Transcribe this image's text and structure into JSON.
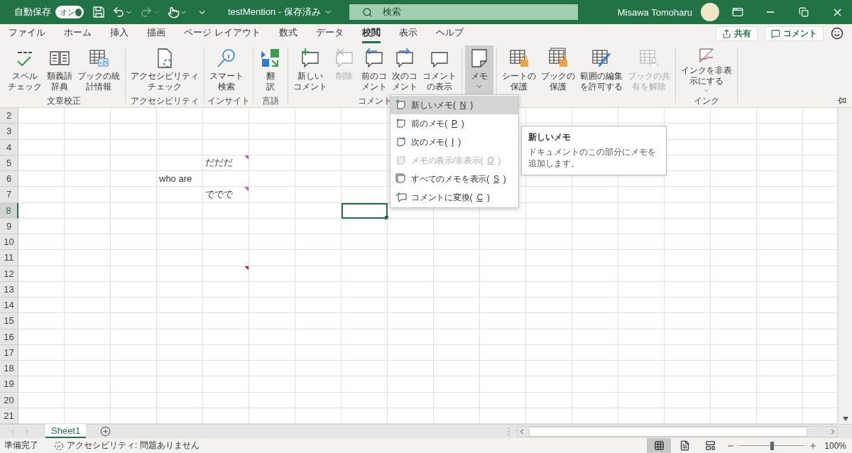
{
  "title_bar": {
    "autosave_label": "自動保存",
    "autosave_toggle": {
      "label": "オン",
      "on": true
    },
    "document_title": "testMention - 保存済み",
    "search": {
      "placeholder": "検索"
    },
    "user_name": "Misawa Tomoharu"
  },
  "tabs": [
    {
      "label": "ファイル",
      "selected": false
    },
    {
      "label": "ホーム",
      "selected": false
    },
    {
      "label": "挿入",
      "selected": false
    },
    {
      "label": "描画",
      "selected": false
    },
    {
      "label": "ページ レイアウト",
      "selected": false
    },
    {
      "label": "数式",
      "selected": false
    },
    {
      "label": "データ",
      "selected": false
    },
    {
      "label": "校閲",
      "selected": true
    },
    {
      "label": "表示",
      "selected": false
    },
    {
      "label": "ヘルプ",
      "selected": false
    }
  ],
  "share_button": "共有",
  "comments_button": "コメント",
  "ribbon_groups": [
    {
      "label": "文章校正",
      "buttons": [
        {
          "kind": "spelling",
          "lines": [
            "スペル",
            "チェック"
          ],
          "disabled": false,
          "expanded": false,
          "dropdown": false
        },
        {
          "kind": "thesaurus",
          "lines": [
            "類義語",
            "辞典"
          ],
          "disabled": false,
          "expanded": false,
          "dropdown": false
        },
        {
          "kind": "workbook-stats",
          "lines": [
            "ブックの統",
            "計情報"
          ],
          "disabled": false,
          "expanded": false,
          "dropdown": false
        }
      ]
    },
    {
      "label": "アクセシビリティ",
      "buttons": [
        {
          "kind": "accessibility",
          "lines": [
            "アクセシビリティ",
            "チェック"
          ],
          "disabled": false,
          "expanded": false,
          "dropdown": false
        }
      ]
    },
    {
      "label": "インサイト",
      "buttons": [
        {
          "kind": "smart-lookup",
          "lines": [
            "スマート",
            "検索"
          ],
          "disabled": false,
          "expanded": false,
          "dropdown": false
        }
      ]
    },
    {
      "label": "言語",
      "buttons": [
        {
          "kind": "translate",
          "lines": [
            "翻",
            "訳"
          ],
          "disabled": false,
          "expanded": false,
          "dropdown": false
        }
      ]
    },
    {
      "label": "コメント",
      "buttons": [
        {
          "kind": "new-comment",
          "lines": [
            "新しい",
            "コメント"
          ],
          "disabled": false,
          "expanded": false,
          "dropdown": false
        },
        {
          "kind": "delete-comment",
          "lines": [
            "削除"
          ],
          "disabled": true,
          "expanded": false,
          "dropdown": false
        },
        {
          "kind": "prev-comment",
          "lines": [
            "前のコ",
            "メント"
          ],
          "disabled": false,
          "expanded": false,
          "dropdown": false
        },
        {
          "kind": "next-comment",
          "lines": [
            "次のコ",
            "メント"
          ],
          "disabled": false,
          "expanded": false,
          "dropdown": false
        },
        {
          "kind": "show-comments",
          "lines": [
            "コメント",
            "の表示"
          ],
          "disabled": false,
          "expanded": false,
          "dropdown": false
        }
      ]
    },
    {
      "buttons": [
        {
          "kind": "note",
          "lines": [
            "メモ"
          ],
          "disabled": false,
          "expanded": true,
          "dropdown": true
        }
      ]
    },
    {
      "buttons": [
        {
          "kind": "protect-sheet",
          "lines": [
            "シートの",
            "保護"
          ],
          "disabled": false,
          "expanded": false,
          "dropdown": false
        },
        {
          "kind": "protect-workbook",
          "lines": [
            "ブックの",
            "保護"
          ],
          "disabled": false,
          "expanded": false,
          "dropdown": false
        },
        {
          "kind": "allow-edit",
          "lines": [
            "範囲の編集",
            "を許可する"
          ],
          "disabled": false,
          "expanded": false,
          "dropdown": false
        },
        {
          "kind": "unshare",
          "lines": [
            "ブックの共",
            "有を解除"
          ],
          "disabled": true,
          "expanded": false,
          "dropdown": false
        }
      ]
    },
    {
      "label": "インク",
      "buttons": [
        {
          "kind": "hide-ink",
          "lines": [
            "インクを非表",
            "示にする"
          ],
          "disabled": false,
          "expanded": false,
          "dropdown": true
        }
      ]
    }
  ],
  "sheet": {
    "rows": [
      {
        "header": "2",
        "selected": false
      },
      {
        "header": "3",
        "selected": false
      },
      {
        "header": "4",
        "selected": false
      },
      {
        "header": "5",
        "selected": false,
        "cells": [
          {
            "kind": "threaded-comment",
            "text": "だだだ",
            "selected": false
          }
        ]
      },
      {
        "header": "6",
        "selected": false,
        "cells": [
          {
            "kind": "plain",
            "text": "who are",
            "selected": false
          }
        ]
      },
      {
        "header": "7",
        "selected": false,
        "cells": [
          {
            "kind": "threaded-comment",
            "text": "ででで",
            "selected": false
          }
        ]
      },
      {
        "header": "8",
        "selected": true,
        "cells": [
          {
            "kind": "plain",
            "selected": true
          }
        ]
      },
      {
        "header": "9",
        "selected": false
      },
      {
        "header": "10",
        "selected": false
      },
      {
        "header": "11",
        "selected": false
      },
      {
        "header": "12",
        "selected": false,
        "cells": [
          {
            "kind": "note",
            "selected": false
          }
        ]
      },
      {
        "header": "13",
        "selected": false
      },
      {
        "header": "14",
        "selected": false
      },
      {
        "header": "15",
        "selected": false
      },
      {
        "header": "16",
        "selected": false
      },
      {
        "header": "17",
        "selected": false
      },
      {
        "header": "18",
        "selected": false
      },
      {
        "header": "19",
        "selected": false
      },
      {
        "header": "20",
        "selected": false
      },
      {
        "header": "21",
        "selected": false
      }
    ]
  },
  "note_menu": {
    "items": [
      {
        "kind": "new-note",
        "before": "新しいメモ(",
        "access_key": "N",
        "after": ")",
        "selected": true,
        "disabled": false
      },
      {
        "kind": "prev-note",
        "before": "前のメモ(",
        "access_key": "P",
        "after": ")",
        "selected": false,
        "disabled": false
      },
      {
        "kind": "next-note",
        "before": "次のメモ(",
        "access_key": "I",
        "after": ")",
        "selected": false,
        "disabled": false
      },
      {
        "kind": "toggle-note",
        "before": "メモの表示/非表示(",
        "access_key": "O",
        "after": ")",
        "selected": false,
        "disabled": true
      },
      {
        "kind": "all-notes",
        "before": "すべてのメモを表示(",
        "access_key": "S",
        "after": ")",
        "selected": false,
        "disabled": false
      },
      {
        "kind": "convert",
        "before": "コメントに変換(",
        "access_key": "C",
        "after": ")",
        "selected": false,
        "disabled": false
      }
    ]
  },
  "tooltip": {
    "title": "新しいメモ",
    "text": "ドキュメントのこの部分にメモを追加します。"
  },
  "sheet_tabs": [
    {
      "label": "Sheet1",
      "selected": true
    }
  ],
  "status_bar": {
    "ready": "準備完了",
    "accessibility": "アクセシビリティ: 問題ありません",
    "views": [
      {
        "kind": "normal",
        "selected": true
      },
      {
        "kind": "page-layout",
        "selected": false
      },
      {
        "kind": "page-break",
        "selected": false
      }
    ],
    "zoom": {
      "level": 0.5,
      "reading": "100%"
    }
  }
}
